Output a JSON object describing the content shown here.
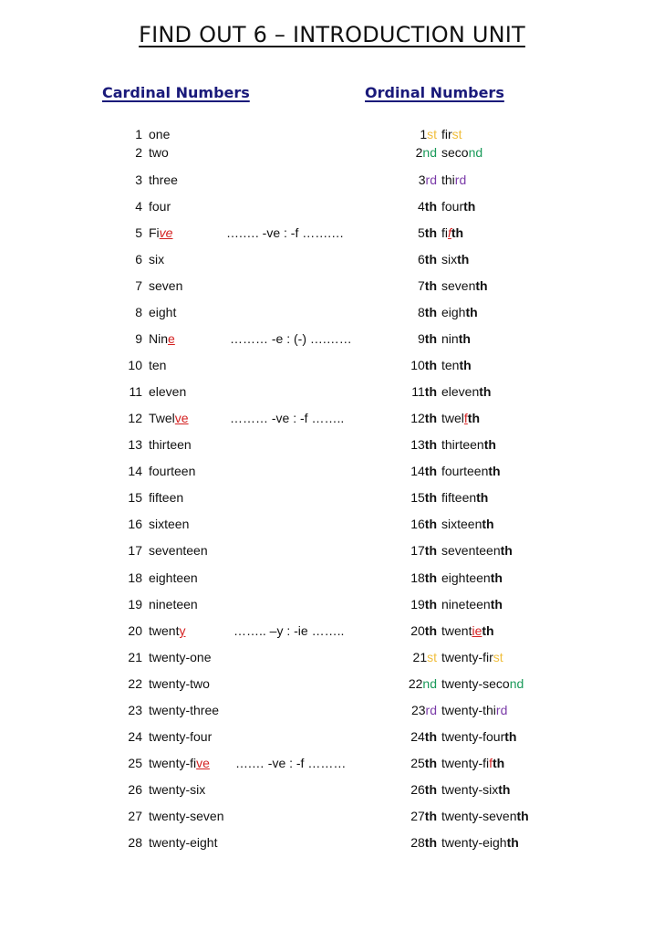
{
  "title": "FIND OUT 6 – INTRODUCTION UNIT",
  "headers": {
    "cardinal": "Cardinal Numbers",
    "ordinal": "Ordinal Numbers"
  },
  "colors": {
    "heading": "#1a1a7a",
    "highlight_red": "#d42020",
    "st": "#f0be3c",
    "nd": "#1a9a5a",
    "rd": "#7a3aa8"
  },
  "rows": [
    {
      "n": "1",
      "card": [
        [
          "one",
          ""
        ]
      ],
      "rule": "",
      "ord_num": [
        [
          "1",
          ""
        ],
        [
          "st",
          "gold"
        ]
      ],
      "ord": [
        [
          "fir",
          ""
        ],
        [
          "st",
          "gold"
        ]
      ]
    },
    {
      "n": "2",
      "card": [
        [
          "two",
          ""
        ]
      ],
      "rule": "",
      "ord_num": [
        [
          "2",
          ""
        ],
        [
          "nd",
          "green"
        ]
      ],
      "ord": [
        [
          "seco",
          ""
        ],
        [
          "nd",
          "green"
        ]
      ]
    },
    {
      "n": "3",
      "card": [
        [
          "three",
          ""
        ]
      ],
      "rule": "",
      "ord_num": [
        [
          "3",
          ""
        ],
        [
          "rd",
          "purple"
        ]
      ],
      "ord": [
        [
          "thi",
          ""
        ],
        [
          "rd",
          "purple"
        ]
      ]
    },
    {
      "n": "4",
      "card": [
        [
          "four",
          ""
        ]
      ],
      "rule": "",
      "ord_num": [
        [
          "4",
          ""
        ],
        [
          "th",
          "bold"
        ]
      ],
      "ord": [
        [
          "four",
          ""
        ],
        [
          "th",
          "bold"
        ]
      ]
    },
    {
      "n": "5",
      "card": [
        [
          "Fi",
          ""
        ],
        [
          "ve",
          "red ital"
        ]
      ],
      "rule": "….…. -ve : -f …….…",
      "ord_num": [
        [
          "5",
          ""
        ],
        [
          "th",
          "bold"
        ]
      ],
      "ord": [
        [
          "fi",
          ""
        ],
        [
          "f",
          "red ital"
        ],
        [
          "th",
          "bold"
        ]
      ]
    },
    {
      "n": "6",
      "card": [
        [
          "six",
          ""
        ]
      ],
      "rule": "",
      "ord_num": [
        [
          "6",
          ""
        ],
        [
          "th",
          "bold"
        ]
      ],
      "ord": [
        [
          "six",
          ""
        ],
        [
          "th",
          "bold"
        ]
      ]
    },
    {
      "n": "7",
      "card": [
        [
          "seven",
          ""
        ]
      ],
      "rule": "",
      "ord_num": [
        [
          "7",
          ""
        ],
        [
          "th",
          "bold"
        ]
      ],
      "ord": [
        [
          "seven",
          ""
        ],
        [
          "th",
          "bold"
        ]
      ]
    },
    {
      "n": "8",
      "card": [
        [
          "eight",
          ""
        ]
      ],
      "rule": "",
      "ord_num": [
        [
          "8",
          ""
        ],
        [
          "th",
          "bold"
        ]
      ],
      "ord": [
        [
          "eigh",
          ""
        ],
        [
          "th",
          "bold"
        ]
      ]
    },
    {
      "n": "9",
      "card": [
        [
          "Nin",
          ""
        ],
        [
          "e",
          "red"
        ]
      ],
      "rule": "……… -e : (-) ….……",
      "ord_num": [
        [
          "9",
          ""
        ],
        [
          "th",
          "bold"
        ]
      ],
      "ord": [
        [
          "nin",
          ""
        ],
        [
          "th",
          "bold"
        ]
      ]
    },
    {
      "n": "10",
      "card": [
        [
          "ten",
          ""
        ]
      ],
      "rule": "",
      "ord_num": [
        [
          "10",
          ""
        ],
        [
          "th",
          "bold"
        ]
      ],
      "ord": [
        [
          "ten",
          ""
        ],
        [
          "th",
          "bold"
        ]
      ]
    },
    {
      "n": "11",
      "card": [
        [
          "eleven",
          ""
        ]
      ],
      "rule": "",
      "ord_num": [
        [
          "11",
          ""
        ],
        [
          "th",
          "bold"
        ]
      ],
      "ord": [
        [
          "eleven",
          ""
        ],
        [
          "th",
          "bold"
        ]
      ]
    },
    {
      "n": "12",
      "card": [
        [
          "Twel",
          ""
        ],
        [
          "ve",
          "red"
        ]
      ],
      "rule": "……… -ve : -f ……..",
      "ord_num": [
        [
          "12",
          ""
        ],
        [
          "th",
          "bold"
        ]
      ],
      "ord": [
        [
          "twel",
          ""
        ],
        [
          "f",
          "red"
        ],
        [
          "th",
          "bold"
        ]
      ]
    },
    {
      "n": "13",
      "card": [
        [
          "thirteen",
          ""
        ]
      ],
      "rule": "",
      "ord_num": [
        [
          "13",
          ""
        ],
        [
          "th",
          "bold"
        ]
      ],
      "ord": [
        [
          "thirteen",
          ""
        ],
        [
          "th",
          "bold"
        ]
      ]
    },
    {
      "n": "14",
      "card": [
        [
          "fourteen",
          ""
        ]
      ],
      "rule": "",
      "ord_num": [
        [
          "14",
          ""
        ],
        [
          "th",
          "bold"
        ]
      ],
      "ord": [
        [
          "fourteen",
          ""
        ],
        [
          "th",
          "bold"
        ]
      ]
    },
    {
      "n": "15",
      "card": [
        [
          "fifteen",
          ""
        ]
      ],
      "rule": "",
      "ord_num": [
        [
          "15",
          ""
        ],
        [
          "th",
          "bold"
        ]
      ],
      "ord": [
        [
          "fifteen",
          ""
        ],
        [
          "th",
          "bold"
        ]
      ]
    },
    {
      "n": "16",
      "card": [
        [
          "sixteen",
          ""
        ]
      ],
      "rule": "",
      "ord_num": [
        [
          "16",
          ""
        ],
        [
          "th",
          "bold"
        ]
      ],
      "ord": [
        [
          "sixteen",
          ""
        ],
        [
          "th",
          "bold"
        ]
      ]
    },
    {
      "n": "17",
      "card": [
        [
          "seventeen",
          ""
        ]
      ],
      "rule": "",
      "ord_num": [
        [
          "17",
          ""
        ],
        [
          "th",
          "bold"
        ]
      ],
      "ord": [
        [
          "seventeen",
          ""
        ],
        [
          "th",
          "bold"
        ]
      ]
    },
    {
      "n": "18",
      "card": [
        [
          "eighteen",
          ""
        ]
      ],
      "rule": "",
      "ord_num": [
        [
          "18",
          ""
        ],
        [
          "th",
          "bold"
        ]
      ],
      "ord": [
        [
          "eighteen",
          ""
        ],
        [
          "th",
          "bold"
        ]
      ]
    },
    {
      "n": "19",
      "card": [
        [
          "nineteen",
          ""
        ]
      ],
      "rule": "",
      "ord_num": [
        [
          "19",
          ""
        ],
        [
          "th",
          "bold"
        ]
      ],
      "ord": [
        [
          "nineteen",
          ""
        ],
        [
          "th",
          "bold"
        ]
      ]
    },
    {
      "n": "20",
      "card": [
        [
          "twent",
          ""
        ],
        [
          "y",
          "red"
        ]
      ],
      "rule": "…….. –y : -ie ……..",
      "ord_num": [
        [
          "20",
          ""
        ],
        [
          "th",
          "bold"
        ]
      ],
      "ord": [
        [
          "twent",
          ""
        ],
        [
          "ie",
          "red"
        ],
        [
          "th",
          "bold"
        ]
      ]
    },
    {
      "n": "21",
      "card": [
        [
          "twenty-one",
          ""
        ]
      ],
      "rule": "",
      "ord_num": [
        [
          "21",
          ""
        ],
        [
          "st",
          "gold"
        ]
      ],
      "ord": [
        [
          "twenty-fir",
          ""
        ],
        [
          "st",
          "gold"
        ]
      ]
    },
    {
      "n": "22",
      "card": [
        [
          "twenty-two",
          ""
        ]
      ],
      "rule": "",
      "ord_num": [
        [
          "22",
          ""
        ],
        [
          "nd",
          "green"
        ]
      ],
      "ord": [
        [
          "twenty-seco",
          ""
        ],
        [
          "nd",
          "green"
        ]
      ]
    },
    {
      "n": "23",
      "card": [
        [
          "twenty-three",
          ""
        ]
      ],
      "rule": "",
      "ord_num": [
        [
          "23",
          ""
        ],
        [
          "rd",
          "purple"
        ]
      ],
      "ord": [
        [
          "twenty-thi",
          ""
        ],
        [
          "rd",
          "purple"
        ]
      ]
    },
    {
      "n": "24",
      "card": [
        [
          "twenty-four",
          ""
        ]
      ],
      "rule": "",
      "ord_num": [
        [
          "24",
          ""
        ],
        [
          "th",
          "bold"
        ]
      ],
      "ord": [
        [
          "twenty-four",
          ""
        ],
        [
          "th",
          "bold"
        ]
      ]
    },
    {
      "n": "25",
      "card": [
        [
          "twenty-fi",
          ""
        ],
        [
          "ve",
          "red"
        ]
      ],
      "rule": "….… -ve : -f ………",
      "ord_num": [
        [
          "25",
          ""
        ],
        [
          "th",
          "bold"
        ]
      ],
      "ord": [
        [
          "twenty-fi",
          ""
        ],
        [
          "f",
          "redplain"
        ],
        [
          "th",
          "bold"
        ]
      ]
    },
    {
      "n": "26",
      "card": [
        [
          "twenty-six",
          ""
        ]
      ],
      "rule": "",
      "ord_num": [
        [
          "26",
          ""
        ],
        [
          "th",
          "bold"
        ]
      ],
      "ord": [
        [
          "twenty-six",
          ""
        ],
        [
          "th",
          "bold"
        ]
      ]
    },
    {
      "n": "27",
      "card": [
        [
          "twenty-seven",
          ""
        ]
      ],
      "rule": "",
      "ord_num": [
        [
          "27",
          ""
        ],
        [
          "th",
          "bold"
        ]
      ],
      "ord": [
        [
          "twenty-seven",
          ""
        ],
        [
          "th",
          "bold"
        ]
      ]
    },
    {
      "n": "28",
      "card": [
        [
          "twenty-eight",
          ""
        ]
      ],
      "rule": "",
      "ord_num": [
        [
          "28",
          ""
        ],
        [
          "th",
          "bold"
        ]
      ],
      "ord": [
        [
          "twenty-eigh",
          ""
        ],
        [
          "th",
          "bold"
        ]
      ]
    }
  ]
}
